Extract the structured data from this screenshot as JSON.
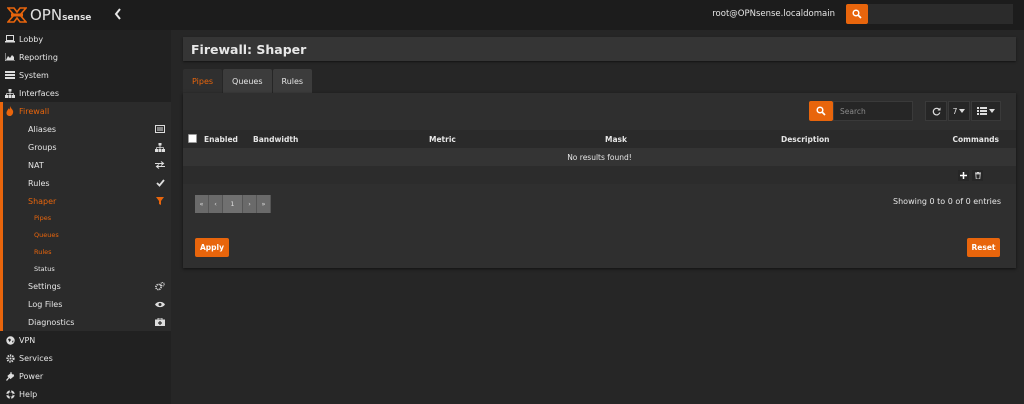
{
  "header": {
    "logo_main": "OPN",
    "logo_sub": "sense",
    "user": "root@OPNsense.localdomain"
  },
  "sidebar": {
    "items": [
      {
        "label": "Lobby",
        "icon": "laptop-icon"
      },
      {
        "label": "Reporting",
        "icon": "area-chart-icon"
      },
      {
        "label": "System",
        "icon": "server-icon"
      },
      {
        "label": "Interfaces",
        "icon": "sitemap-icon"
      },
      {
        "label": "Firewall",
        "icon": "fire-icon"
      }
    ],
    "firewall_sub": [
      {
        "label": "Aliases",
        "icon": "list-alt-icon"
      },
      {
        "label": "Groups",
        "icon": "sitemap-icon"
      },
      {
        "label": "NAT",
        "icon": "exchange-icon"
      },
      {
        "label": "Rules",
        "icon": "check-icon"
      },
      {
        "label": "Shaper",
        "icon": "filter-icon"
      }
    ],
    "shaper_sub": [
      "Pipes",
      "Queues",
      "Rules",
      "Status"
    ],
    "firewall_sub2": [
      {
        "label": "Settings",
        "icon": "cogs-icon"
      },
      {
        "label": "Log Files",
        "icon": "eye-icon"
      },
      {
        "label": "Diagnostics",
        "icon": "medkit-icon"
      }
    ],
    "bottom": [
      {
        "label": "VPN",
        "icon": "globe-icon"
      },
      {
        "label": "Services",
        "icon": "cog-icon"
      },
      {
        "label": "Power",
        "icon": "plug-icon"
      },
      {
        "label": "Help",
        "icon": "life-ring-icon"
      }
    ]
  },
  "page": {
    "title": "Firewall: Shaper",
    "tabs": [
      "Pipes",
      "Queues",
      "Rules"
    ]
  },
  "grid": {
    "search_placeholder": "Search",
    "rows_per_page": "7",
    "columns": [
      "Enabled",
      "Bandwidth",
      "Metric",
      "Mask",
      "Description",
      "Commands"
    ],
    "empty": "No results found!",
    "pager": [
      "«",
      "‹",
      "1",
      "›",
      "»"
    ],
    "showing": "Showing 0 to 0 of 0 entries"
  },
  "buttons": {
    "apply": "Apply",
    "reset": "Reset"
  },
  "colors": {
    "accent": "#e8650c",
    "topbar": "#1c1c1c",
    "sidebar": "#212121"
  }
}
